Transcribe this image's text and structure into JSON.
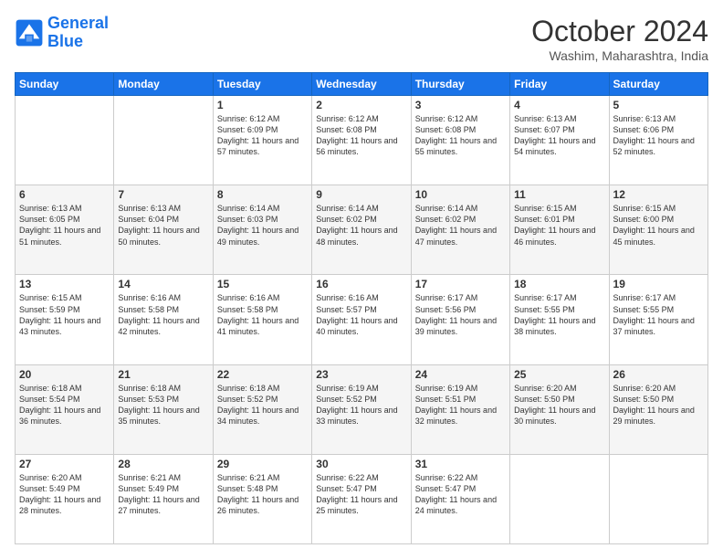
{
  "logo": {
    "line1": "General",
    "line2": "Blue"
  },
  "title": "October 2024",
  "subtitle": "Washim, Maharashtra, India",
  "days_of_week": [
    "Sunday",
    "Monday",
    "Tuesday",
    "Wednesday",
    "Thursday",
    "Friday",
    "Saturday"
  ],
  "weeks": [
    [
      {
        "day": "",
        "info": ""
      },
      {
        "day": "",
        "info": ""
      },
      {
        "day": "1",
        "info": "Sunrise: 6:12 AM\nSunset: 6:09 PM\nDaylight: 11 hours and 57 minutes."
      },
      {
        "day": "2",
        "info": "Sunrise: 6:12 AM\nSunset: 6:08 PM\nDaylight: 11 hours and 56 minutes."
      },
      {
        "day": "3",
        "info": "Sunrise: 6:12 AM\nSunset: 6:08 PM\nDaylight: 11 hours and 55 minutes."
      },
      {
        "day": "4",
        "info": "Sunrise: 6:13 AM\nSunset: 6:07 PM\nDaylight: 11 hours and 54 minutes."
      },
      {
        "day": "5",
        "info": "Sunrise: 6:13 AM\nSunset: 6:06 PM\nDaylight: 11 hours and 52 minutes."
      }
    ],
    [
      {
        "day": "6",
        "info": "Sunrise: 6:13 AM\nSunset: 6:05 PM\nDaylight: 11 hours and 51 minutes."
      },
      {
        "day": "7",
        "info": "Sunrise: 6:13 AM\nSunset: 6:04 PM\nDaylight: 11 hours and 50 minutes."
      },
      {
        "day": "8",
        "info": "Sunrise: 6:14 AM\nSunset: 6:03 PM\nDaylight: 11 hours and 49 minutes."
      },
      {
        "day": "9",
        "info": "Sunrise: 6:14 AM\nSunset: 6:02 PM\nDaylight: 11 hours and 48 minutes."
      },
      {
        "day": "10",
        "info": "Sunrise: 6:14 AM\nSunset: 6:02 PM\nDaylight: 11 hours and 47 minutes."
      },
      {
        "day": "11",
        "info": "Sunrise: 6:15 AM\nSunset: 6:01 PM\nDaylight: 11 hours and 46 minutes."
      },
      {
        "day": "12",
        "info": "Sunrise: 6:15 AM\nSunset: 6:00 PM\nDaylight: 11 hours and 45 minutes."
      }
    ],
    [
      {
        "day": "13",
        "info": "Sunrise: 6:15 AM\nSunset: 5:59 PM\nDaylight: 11 hours and 43 minutes."
      },
      {
        "day": "14",
        "info": "Sunrise: 6:16 AM\nSunset: 5:58 PM\nDaylight: 11 hours and 42 minutes."
      },
      {
        "day": "15",
        "info": "Sunrise: 6:16 AM\nSunset: 5:58 PM\nDaylight: 11 hours and 41 minutes."
      },
      {
        "day": "16",
        "info": "Sunrise: 6:16 AM\nSunset: 5:57 PM\nDaylight: 11 hours and 40 minutes."
      },
      {
        "day": "17",
        "info": "Sunrise: 6:17 AM\nSunset: 5:56 PM\nDaylight: 11 hours and 39 minutes."
      },
      {
        "day": "18",
        "info": "Sunrise: 6:17 AM\nSunset: 5:55 PM\nDaylight: 11 hours and 38 minutes."
      },
      {
        "day": "19",
        "info": "Sunrise: 6:17 AM\nSunset: 5:55 PM\nDaylight: 11 hours and 37 minutes."
      }
    ],
    [
      {
        "day": "20",
        "info": "Sunrise: 6:18 AM\nSunset: 5:54 PM\nDaylight: 11 hours and 36 minutes."
      },
      {
        "day": "21",
        "info": "Sunrise: 6:18 AM\nSunset: 5:53 PM\nDaylight: 11 hours and 35 minutes."
      },
      {
        "day": "22",
        "info": "Sunrise: 6:18 AM\nSunset: 5:52 PM\nDaylight: 11 hours and 34 minutes."
      },
      {
        "day": "23",
        "info": "Sunrise: 6:19 AM\nSunset: 5:52 PM\nDaylight: 11 hours and 33 minutes."
      },
      {
        "day": "24",
        "info": "Sunrise: 6:19 AM\nSunset: 5:51 PM\nDaylight: 11 hours and 32 minutes."
      },
      {
        "day": "25",
        "info": "Sunrise: 6:20 AM\nSunset: 5:50 PM\nDaylight: 11 hours and 30 minutes."
      },
      {
        "day": "26",
        "info": "Sunrise: 6:20 AM\nSunset: 5:50 PM\nDaylight: 11 hours and 29 minutes."
      }
    ],
    [
      {
        "day": "27",
        "info": "Sunrise: 6:20 AM\nSunset: 5:49 PM\nDaylight: 11 hours and 28 minutes."
      },
      {
        "day": "28",
        "info": "Sunrise: 6:21 AM\nSunset: 5:49 PM\nDaylight: 11 hours and 27 minutes."
      },
      {
        "day": "29",
        "info": "Sunrise: 6:21 AM\nSunset: 5:48 PM\nDaylight: 11 hours and 26 minutes."
      },
      {
        "day": "30",
        "info": "Sunrise: 6:22 AM\nSunset: 5:47 PM\nDaylight: 11 hours and 25 minutes."
      },
      {
        "day": "31",
        "info": "Sunrise: 6:22 AM\nSunset: 5:47 PM\nDaylight: 11 hours and 24 minutes."
      },
      {
        "day": "",
        "info": ""
      },
      {
        "day": "",
        "info": ""
      }
    ]
  ]
}
